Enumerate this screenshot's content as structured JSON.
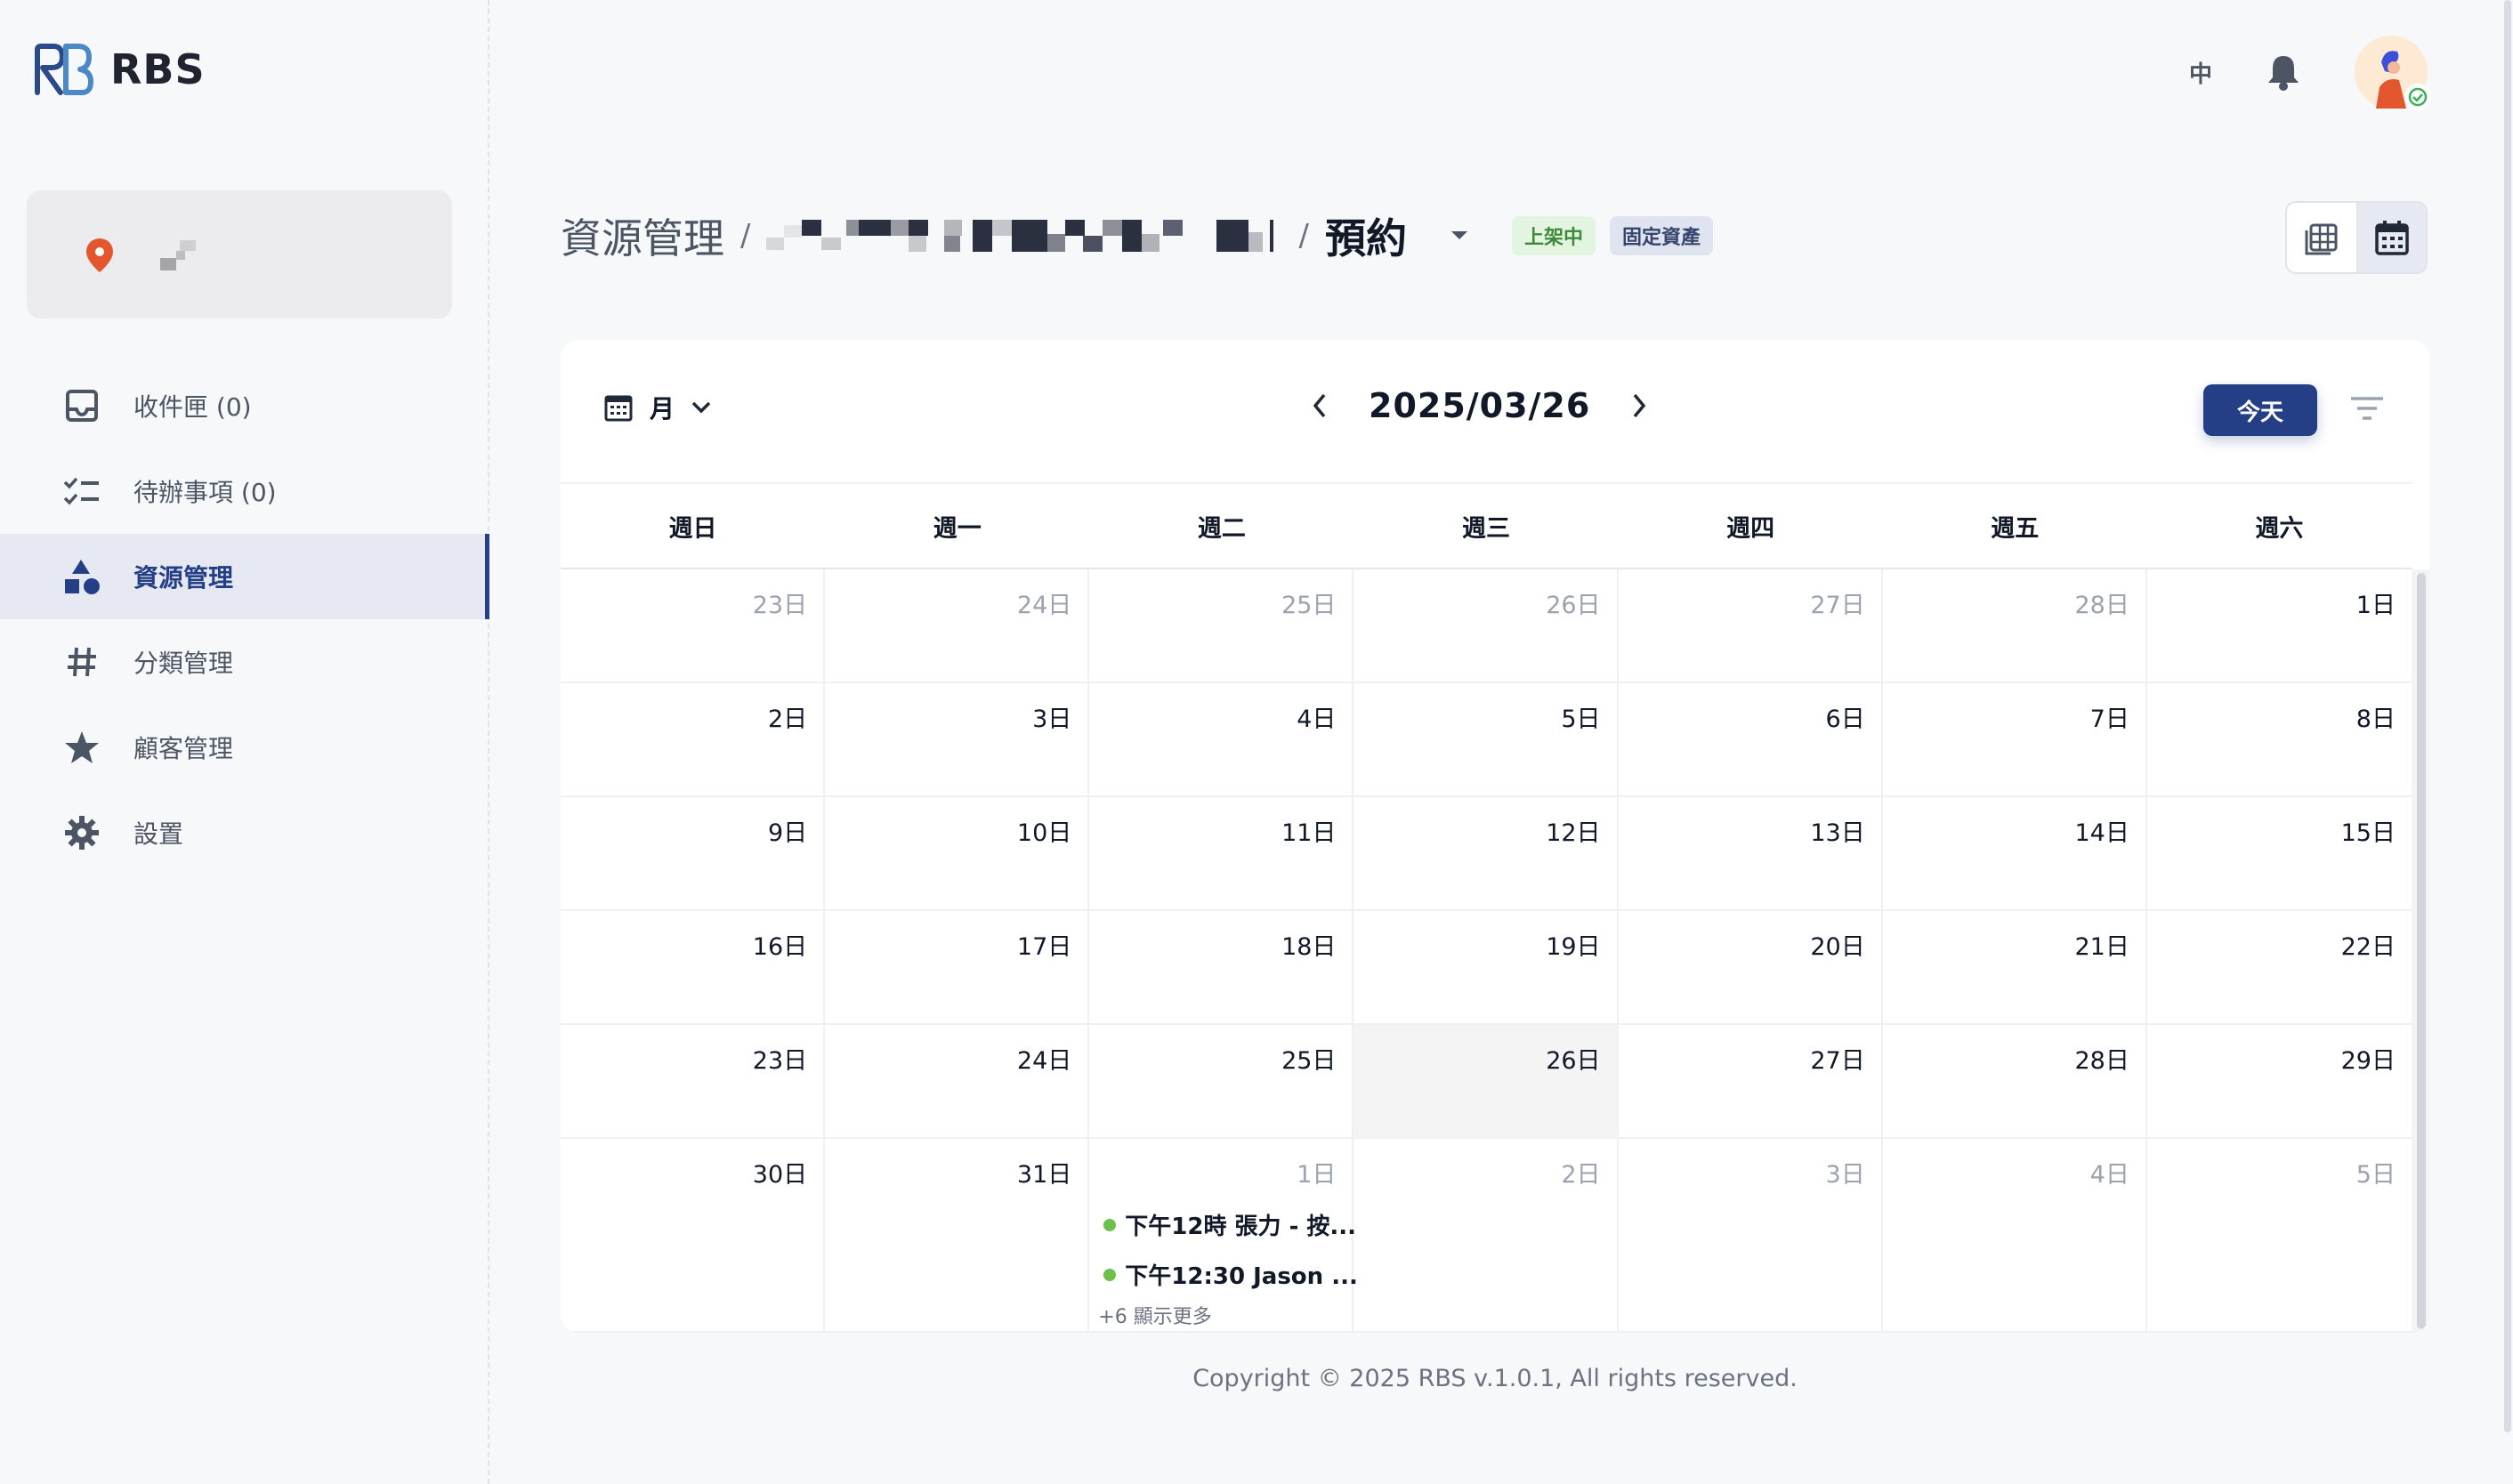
{
  "app": {
    "name": "RBS"
  },
  "colors": {
    "brand": "#243f86",
    "event_dot": "#6cc04a",
    "tag_green": "#3c8a3a",
    "location_pin": "#e4572e"
  },
  "sidebar": {
    "items": [
      {
        "label": "收件匣 (0)",
        "icon": "inbox-icon",
        "active": false
      },
      {
        "label": "待辦事項 (0)",
        "icon": "checklist-icon",
        "active": false
      },
      {
        "label": "資源管理",
        "icon": "shapes-icon",
        "active": true
      },
      {
        "label": "分類管理",
        "icon": "hash-icon",
        "active": false
      },
      {
        "label": "顧客管理",
        "icon": "star-icon",
        "active": false
      },
      {
        "label": "設置",
        "icon": "gear-icon",
        "active": false
      }
    ]
  },
  "topbar": {
    "language": "中"
  },
  "header": {
    "breadcrumb_root": "資源管理",
    "separator": "/",
    "current": "預約",
    "tags": [
      "上架中",
      "固定資產"
    ]
  },
  "calendar": {
    "view_label": "月",
    "date": "2025/03/26",
    "today_label": "今天",
    "weekdays": [
      "週日",
      "週一",
      "週二",
      "週三",
      "週四",
      "週五",
      "週六"
    ],
    "days": [
      "23日",
      "24日",
      "25日",
      "26日",
      "27日",
      "28日",
      "1日",
      "2日",
      "3日",
      "4日",
      "5日",
      "6日",
      "7日",
      "8日",
      "9日",
      "10日",
      "11日",
      "12日",
      "13日",
      "14日",
      "15日",
      "16日",
      "17日",
      "18日",
      "19日",
      "20日",
      "21日",
      "22日",
      "23日",
      "24日",
      "25日",
      "26日",
      "27日",
      "28日",
      "29日",
      "30日",
      "31日",
      "1日",
      "2日",
      "3日",
      "4日",
      "5日"
    ],
    "events": [
      "下午12時 張力 - 按...",
      "下午12:30 Jason ..."
    ],
    "more_label": "+6 顯示更多"
  },
  "footer": {
    "copyright": "Copyright © 2025 RBS v.1.0.1, All rights reserved."
  }
}
